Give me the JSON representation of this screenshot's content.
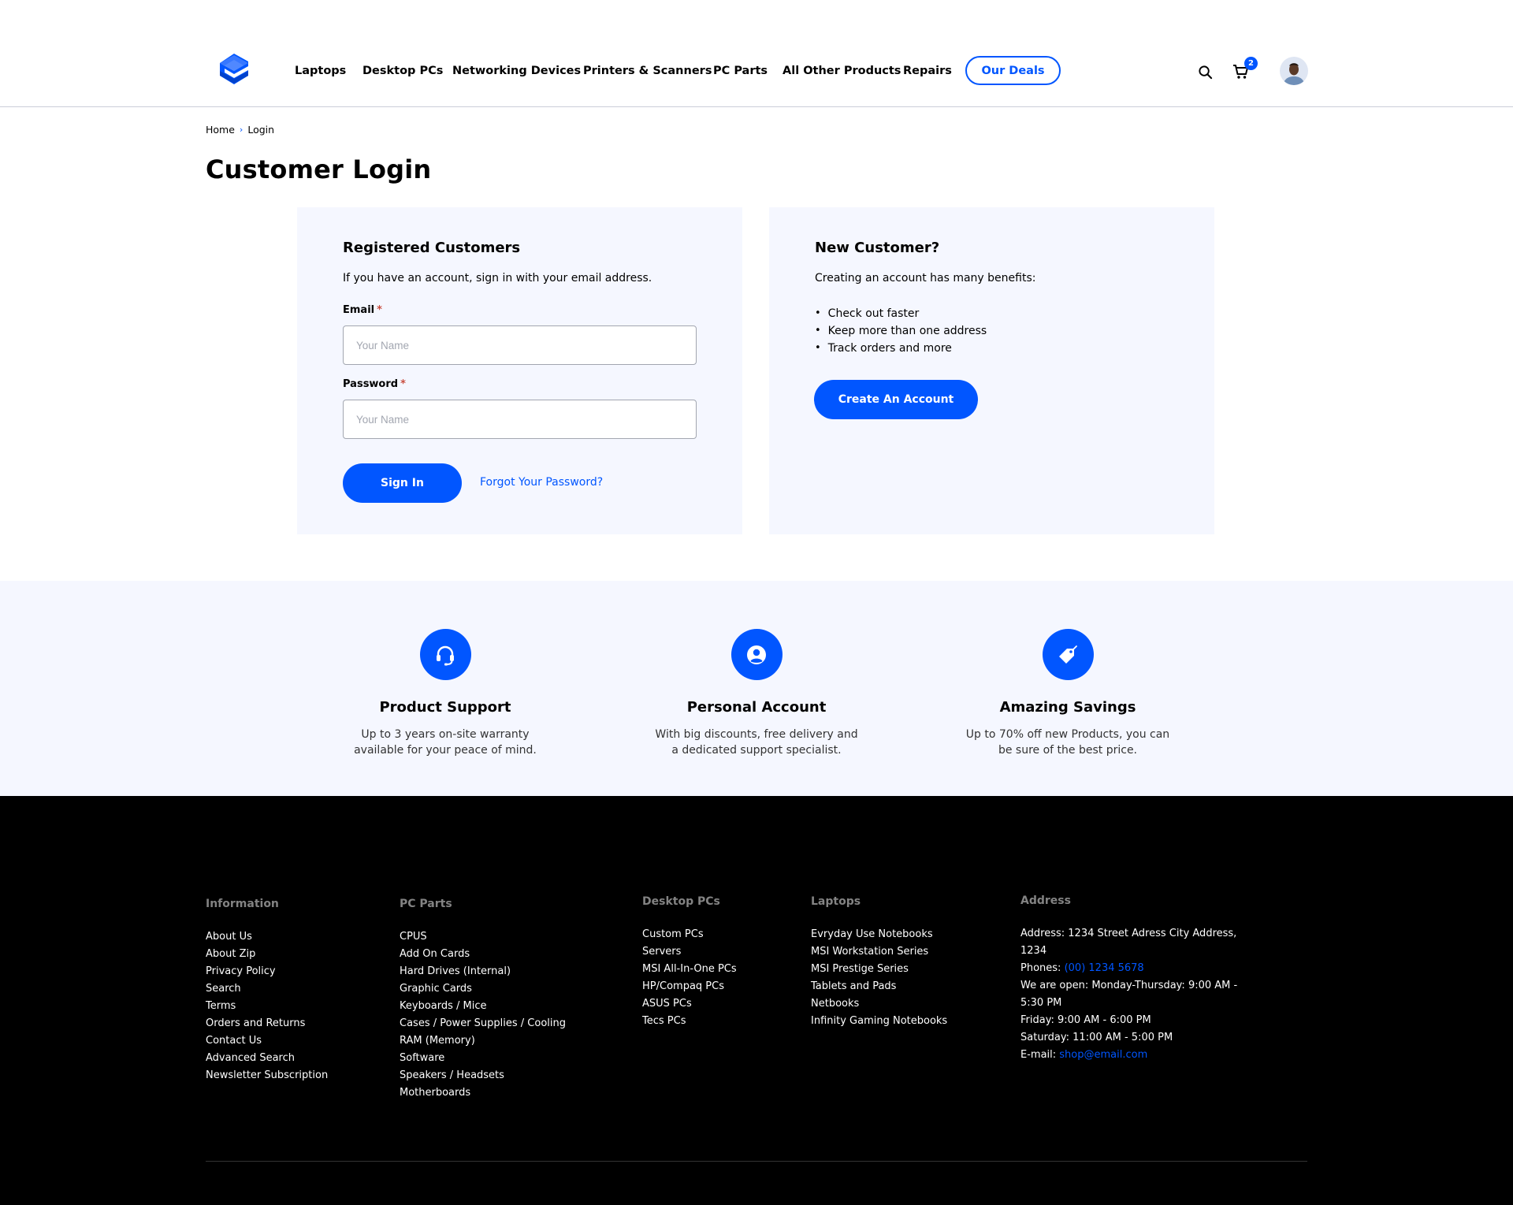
{
  "header": {
    "nav": [
      {
        "label": "Laptops"
      },
      {
        "label": "Desktop PCs"
      },
      {
        "label": "Networking Devices"
      },
      {
        "label": "Printers & Scanners"
      },
      {
        "label": "PC Parts"
      },
      {
        "label": "All Other Products"
      },
      {
        "label": "Repairs"
      }
    ],
    "deals_label": "Our Deals",
    "cart_count": "2"
  },
  "breadcrumb": {
    "home": "Home",
    "sep": "›",
    "current": "Login"
  },
  "page_title": "Customer Login",
  "login": {
    "title": "Registered Customers",
    "description": "If you have an account, sign in with your email address.",
    "email_label": "Email",
    "email_placeholder": "Your Name",
    "password_label": "Password",
    "password_placeholder": "Your Name",
    "required_mark": "*",
    "sign_in_label": "Sign In",
    "forgot_label": "Forgot Your Password?"
  },
  "new_customer": {
    "title": "New Customer?",
    "description": "Creating an account has many benefits:",
    "benefits": [
      "Check out faster",
      "Keep more than one address",
      "Track orders and more"
    ],
    "create_label": "Create An Account"
  },
  "features": [
    {
      "icon": "headset-icon",
      "title": "Product Support",
      "line1": "Up to 3 years on-site warranty",
      "line2": "available for your peace of mind."
    },
    {
      "icon": "user-icon",
      "title": "Personal Account",
      "line1": "With big discounts, free delivery and",
      "line2": "a dedicated support specialist."
    },
    {
      "icon": "tag-icon",
      "title": "Amazing Savings",
      "line1": "Up to 70% off new Products, you can",
      "line2": "be sure of the best price."
    }
  ],
  "footer": {
    "information": {
      "heading": "Information",
      "links": [
        "About Us",
        "About Zip",
        "Privacy Policy",
        "Search",
        "Terms",
        "Orders and Returns",
        "Contact Us",
        "Advanced Search",
        "Newsletter Subscription"
      ]
    },
    "pc_parts": {
      "heading": "PC Parts",
      "links": [
        "CPUS",
        "Add On Cards",
        "Hard Drives (Internal)",
        "Graphic Cards",
        "Keyboards / Mice",
        "Cases / Power Supplies / Cooling",
        "RAM (Memory)",
        "Software",
        "Speakers / Headsets",
        "Motherboards"
      ]
    },
    "desktop_pcs": {
      "heading": "Desktop PCs",
      "links": [
        "Custom PCs",
        "Servers",
        "MSI All-In-One PCs",
        "HP/Compaq PCs",
        "ASUS PCs",
        "Tecs PCs"
      ]
    },
    "laptops": {
      "heading": "Laptops",
      "links": [
        "Evryday Use Notebooks",
        "MSI Workstation Series",
        "MSI Prestige Series",
        "Tablets and Pads",
        "Netbooks",
        "Infinity Gaming Notebooks"
      ]
    },
    "address": {
      "heading": "Address",
      "address_line": "Address: 1234 Street Adress City Address, 1234",
      "phones_label": "Phones:",
      "phones_value": "(00) 1234 5678",
      "hours_weekday": "We are open: Monday-Thursday: 9:00 AM - 5:30 PM",
      "hours_friday": "Friday: 9:00 AM - 6:00 PM",
      "hours_saturday": "Saturday: 11:00 AM - 5:00 PM",
      "email_label": "E-mail:",
      "email_value": "shop@email.com"
    }
  },
  "colors": {
    "accent": "#0156ff",
    "panel_bg": "#f5f7ff",
    "footer_bg": "#000000",
    "required": "#c94d3f"
  }
}
